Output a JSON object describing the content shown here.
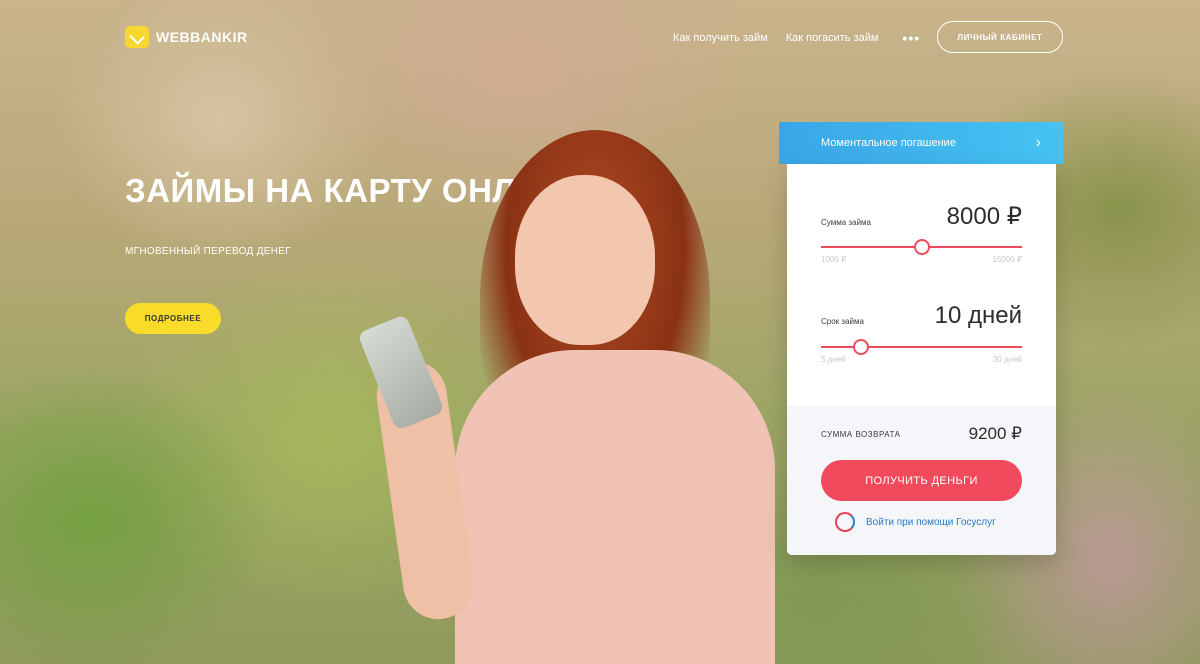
{
  "brand": {
    "name": "WEBBANKIR",
    "logo_color": "#f8d82f"
  },
  "nav": {
    "items": [
      "Как получить займ",
      "Как погасить займ"
    ],
    "more": "•••",
    "cabinet_label": "ЛИЧНЫЙ КАБИНЕТ"
  },
  "hero": {
    "title": "ЗАЙМЫ НА КАРТУ ОНЛАЙН",
    "subtitle": "МГНОВЕННЫЙ ПЕРЕВОД ДЕНЕГ",
    "button": "ПОДРОБНЕЕ"
  },
  "calculator": {
    "header_label": "Моментальное погашение",
    "header_icon": "chevron-right-icon",
    "amount": {
      "caption": "Сумма займа",
      "value": "8000 ₽",
      "min": "1000 ₽",
      "max": "15000 ₽",
      "level": 0.5
    },
    "term": {
      "caption": "Срок займа",
      "value": "10 дней",
      "min": "5 дней",
      "max": "30 дней",
      "level": 0.2
    },
    "return": {
      "caption": "СУММА ВОЗВРАТА",
      "value": "9200 ₽"
    },
    "submit": "ПОЛУЧИТЬ ДЕНЬГИ",
    "gosuslugi": {
      "label": "Войти при помощи Госуслуг",
      "icon": "gosuslugi-icon"
    }
  },
  "colors": {
    "accent": "#f24a5d",
    "header_blue": "#3aa6e8",
    "button_yellow": "#f9dc2a",
    "link": "#2d78c4"
  }
}
